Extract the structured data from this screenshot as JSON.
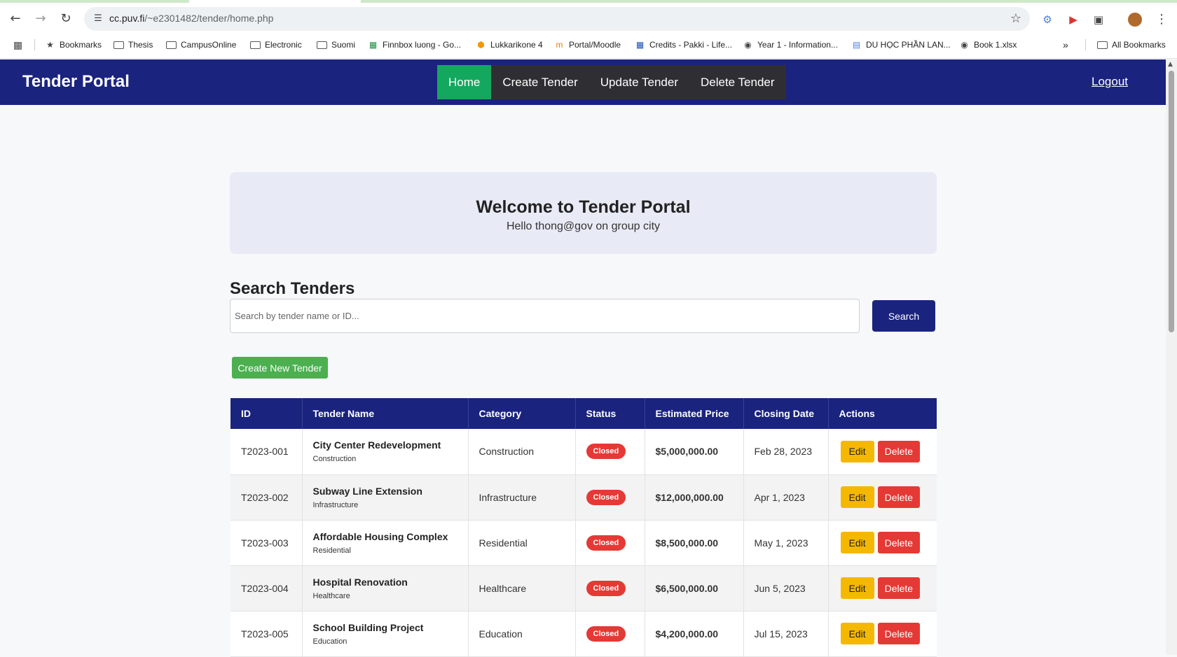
{
  "browser": {
    "url_host": "cc.puv.fi",
    "url_path": "/~e2301482/tender/home.php",
    "bookmarks": [
      {
        "label": "Bookmarks",
        "icon": "star-icon"
      },
      {
        "label": "Thesis",
        "icon": "folder-icon"
      },
      {
        "label": "CampusOnline",
        "icon": "folder-icon"
      },
      {
        "label": "Electronic",
        "icon": "folder-icon"
      },
      {
        "label": "Suomi",
        "icon": "folder-icon"
      },
      {
        "label": "Finnbox luong - Go...",
        "icon": "sheets-icon"
      },
      {
        "label": "Lukkarikone 4",
        "icon": "lukkari-icon"
      },
      {
        "label": "Portal/Moodle",
        "icon": "moodle-icon"
      },
      {
        "label": "Credits - Pakki - Life...",
        "icon": "grid-icon"
      },
      {
        "label": "Year 1 - Information...",
        "icon": "globe-icon"
      },
      {
        "label": "DU HỌC PHẦN LAN...",
        "icon": "docs-icon"
      },
      {
        "label": "Book 1.xlsx",
        "icon": "globe-icon"
      }
    ],
    "all_bookmarks": "All Bookmarks"
  },
  "header": {
    "brand": "Tender Portal",
    "nav": [
      {
        "label": "Home",
        "active": true
      },
      {
        "label": "Create Tender",
        "active": false
      },
      {
        "label": "Update Tender",
        "active": false
      },
      {
        "label": "Delete Tender",
        "active": false
      }
    ],
    "logout": "Logout"
  },
  "welcome": {
    "title": "Welcome to Tender Portal",
    "subtitle": "Hello thong@gov on group city"
  },
  "search": {
    "title": "Search Tenders",
    "placeholder": "Search by tender name or ID...",
    "button": "Search"
  },
  "create_button": "Create New Tender",
  "table": {
    "columns": [
      "ID",
      "Tender Name",
      "Category",
      "Status",
      "Estimated Price",
      "Closing Date",
      "Actions"
    ],
    "rows": [
      {
        "id": "T2023-001",
        "name": "City Center Redevelopment",
        "sub": "Construction",
        "category": "Construction",
        "status": "Closed",
        "price": "$5,000,000.00",
        "closing": "Feb 28, 2023",
        "edit": "Edit",
        "delete": "Delete"
      },
      {
        "id": "T2023-002",
        "name": "Subway Line Extension",
        "sub": "Infrastructure",
        "category": "Infrastructure",
        "status": "Closed",
        "price": "$12,000,000.00",
        "closing": "Apr 1, 2023",
        "edit": "Edit",
        "delete": "Delete"
      },
      {
        "id": "T2023-003",
        "name": "Affordable Housing Complex",
        "sub": "Residential",
        "category": "Residential",
        "status": "Closed",
        "price": "$8,500,000.00",
        "closing": "May 1, 2023",
        "edit": "Edit",
        "delete": "Delete"
      },
      {
        "id": "T2023-004",
        "name": "Hospital Renovation",
        "sub": "Healthcare",
        "category": "Healthcare",
        "status": "Closed",
        "price": "$6,500,000.00",
        "closing": "Jun 5, 2023",
        "edit": "Edit",
        "delete": "Delete"
      },
      {
        "id": "T2023-005",
        "name": "School Building Project",
        "sub": "Education",
        "category": "Education",
        "status": "Closed",
        "price": "$4,200,000.00",
        "closing": "Jul 15, 2023",
        "edit": "Edit",
        "delete": "Delete"
      }
    ]
  },
  "colors": {
    "header_bg": "#1a237e",
    "nav_active": "#14a85f",
    "create_button": "#4caf50",
    "status_closed": "#e53935",
    "price_text": "#16a34a",
    "edit_button": "#f5b800",
    "delete_button": "#e53935"
  }
}
